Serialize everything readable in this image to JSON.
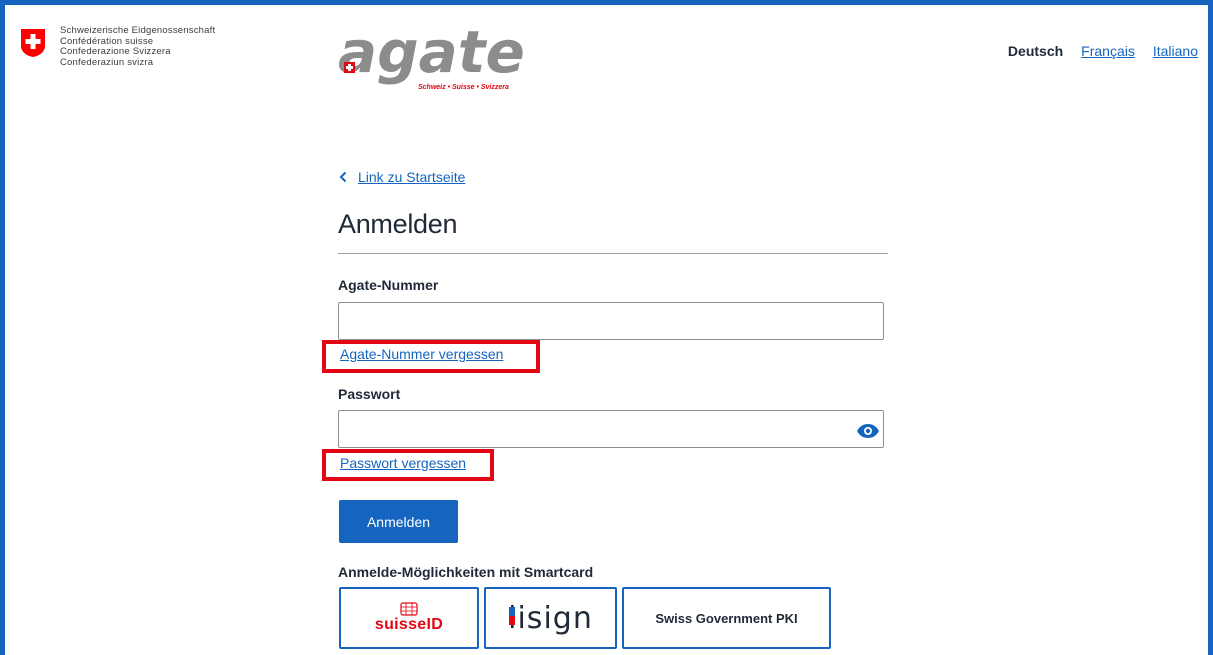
{
  "header": {
    "federation_lines": [
      "Schweizerische Eidgenossenschaft",
      "Confédération suisse",
      "Confederazione Svizzera",
      "Confederaziun svizra"
    ],
    "logo_word": "agate",
    "logo_tagline": "Schweiz • Suisse • Svizzera",
    "languages": {
      "current": "Deutsch",
      "links": [
        "Français",
        "Italiano"
      ]
    }
  },
  "main": {
    "back_link": "Link zu Startseite",
    "title": "Anmelden",
    "agate_number_label": "Agate-Nummer",
    "agate_number_value": "",
    "agate_forgot_link": "Agate-Nummer vergessen",
    "password_label": "Passwort",
    "password_value": "",
    "password_forgot_link": "Passwort vergessen",
    "submit_button": "Anmelden",
    "smartcard_title": "Anmelde-Möglichkeiten mit Smartcard",
    "smartcards": {
      "suisseid": "suisseID",
      "lisign": "lisign",
      "pki": "Swiss Government PKI"
    }
  },
  "colors": {
    "accent": "#1565c0",
    "highlight": "#e30613",
    "swiss_red": "#ff0000"
  },
  "icons": {
    "back": "chevron-left-icon",
    "password_visibility": "eye-icon",
    "federation": "swiss-cross-icon"
  }
}
